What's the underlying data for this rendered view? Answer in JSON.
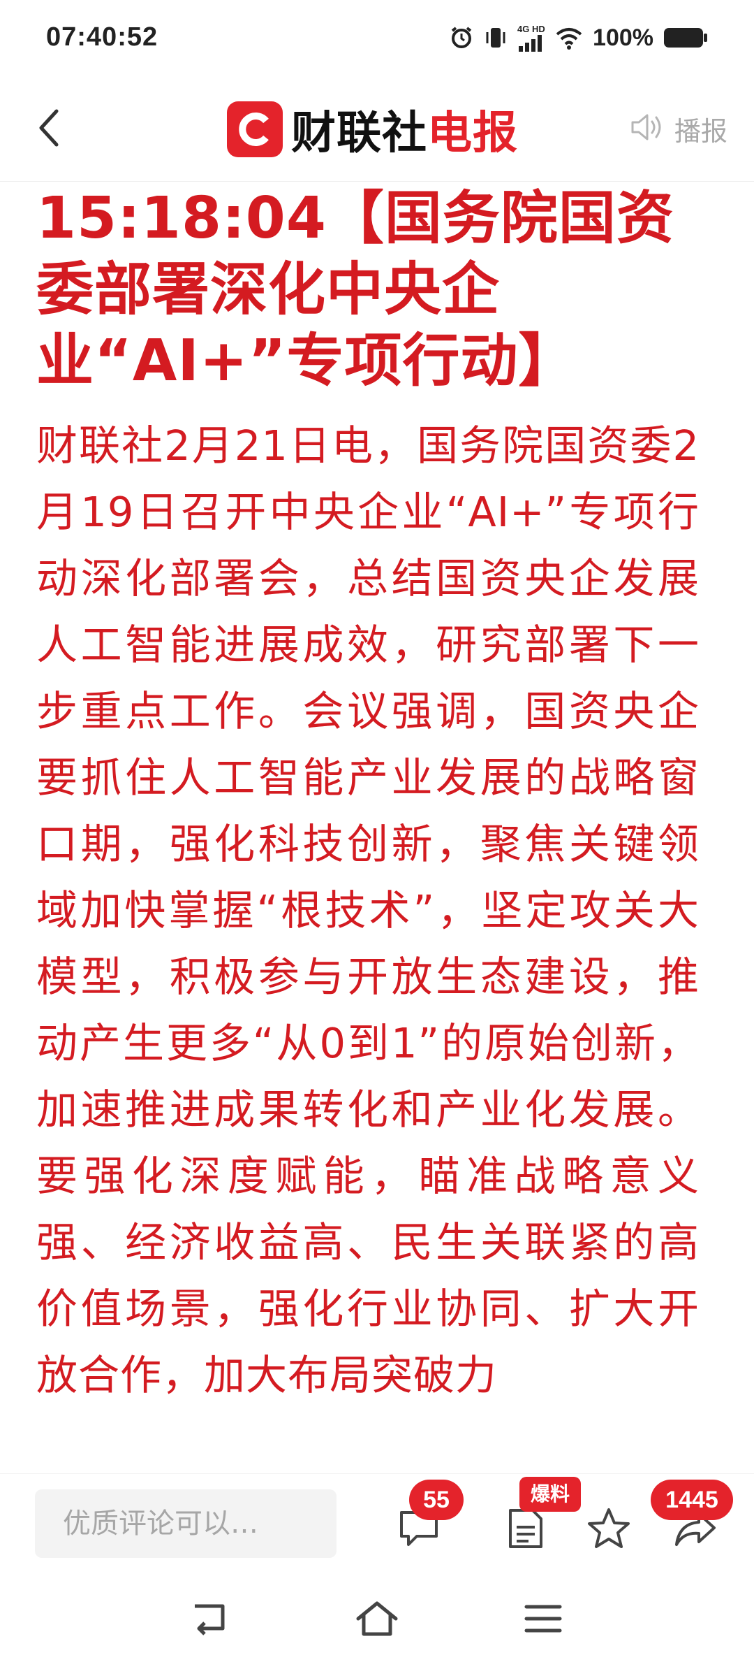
{
  "status_bar": {
    "time": "07:40:52",
    "network_top": "4G HD",
    "battery": "100%",
    "icons": [
      "alarm-icon",
      "vibrate-icon",
      "signal-icon",
      "wifi-icon",
      "battery-icon"
    ]
  },
  "header": {
    "brand_name": "财联社",
    "brand_suffix": "电报",
    "broadcast_label": "播报",
    "icons": [
      "back-icon",
      "brand-c-logo",
      "speaker-icon"
    ]
  },
  "article": {
    "headline": "15:18:04【国务院国资委部署深化中央企业“AI+”专项行动】",
    "body": "财联社2月21日电，国务院国资委2月19日召开中央企业“AI+”专项行动深化部署会，总结国资央企发展人工智能进展成效，研究部署下一步重点工作。会议强调，国资央企要抓住人工智能产业发展的战略窗口期，强化科技创新，聚焦关键领域加快掌握“根技术”，坚定攻关大模型，积极参与开放生态建设，推动产生更多“从0到1”的原始创新，加速推进成果转化和产业化发展。要强化深度赋能，瞄准战略意义强、经济收益高、民生关联紧的高价值场景，强化行业协同、扩大开放合作，加大布局突破力"
  },
  "action_bar": {
    "comment_placeholder": "优质评论可以…",
    "comment_count": "55",
    "tip_label": "爆料",
    "share_count": "1445",
    "icons": [
      "comment-icon",
      "report-icon",
      "star-icon",
      "share-icon"
    ]
  },
  "system_nav": {
    "icons": [
      "back-nav-icon",
      "home-icon",
      "menu-icon"
    ]
  },
  "colors": {
    "accent_red": "#e4232b",
    "article_red": "#d41b21",
    "muted_gray": "#a9a9a9"
  }
}
